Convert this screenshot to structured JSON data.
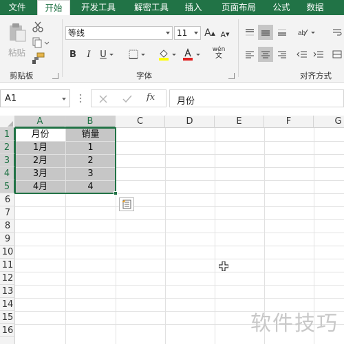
{
  "ribbon": {
    "tabs": [
      {
        "label": "文件",
        "active": false
      },
      {
        "label": "开始",
        "active": true
      },
      {
        "label": "开发工具",
        "active": false
      },
      {
        "label": "解密工具",
        "active": false
      },
      {
        "label": "插入",
        "active": false
      },
      {
        "label": "页面布局",
        "active": false
      },
      {
        "label": "公式",
        "active": false
      },
      {
        "label": "数据",
        "active": false
      }
    ],
    "clipboard": {
      "paste_label": "粘贴",
      "group_label": "剪贴板"
    },
    "font": {
      "name": "等线",
      "size": "11",
      "group_label": "字体",
      "bold": "B",
      "italic": "I",
      "underline": "U",
      "grow": "A",
      "shrink": "A",
      "phonetic": "wén"
    },
    "alignment": {
      "group_label": "对齐方式"
    }
  },
  "formula_bar": {
    "name_box": "A1",
    "fx": "fx",
    "content": "月份"
  },
  "sheet": {
    "columns": [
      "A",
      "B",
      "C",
      "D",
      "E",
      "F",
      "G"
    ],
    "selected_columns": [
      "A",
      "B"
    ],
    "rows": [
      "1",
      "2",
      "3",
      "4",
      "5",
      "6",
      "7",
      "8",
      "9",
      "10",
      "11",
      "12",
      "13",
      "14",
      "15",
      "16"
    ],
    "selected_rows": [
      "1",
      "2",
      "3",
      "4",
      "5"
    ],
    "cells": [
      [
        "月份",
        "销量"
      ],
      [
        "1月",
        "1"
      ],
      [
        "2月",
        "2"
      ],
      [
        "3月",
        "3"
      ],
      [
        "4月",
        "4"
      ]
    ],
    "selection": "A1:B5"
  },
  "watermark": "软件技巧",
  "colors": {
    "accent": "#217346",
    "selection_fill": "#c6c6c6",
    "header_bg": "#f3f3f3"
  }
}
